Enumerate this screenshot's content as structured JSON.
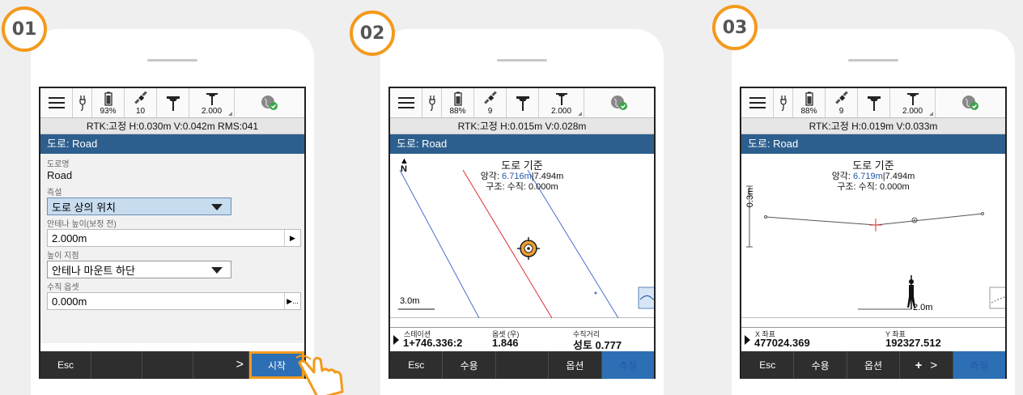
{
  "steps": [
    "01",
    "02",
    "03"
  ],
  "screen1": {
    "battery": "93%",
    "satellites": "10",
    "antenna": "2.000",
    "rtk": "RTK:고정 H:0.030m V:0.042m RMS:041",
    "title": "도로: Road",
    "road_name_label": "도로명",
    "road_name_value": "Road",
    "survey_label": "측설",
    "survey_value": "도로 상의 위치",
    "antenna_height_label": "안테나 높이(보정 전)",
    "antenna_height_value": "2.000m",
    "height_point_label": "높이 지점",
    "height_point_value": "안테나 마운트 하단",
    "vertical_offset_label": "수직 옵셋",
    "vertical_offset_value": "0.000m",
    "vertical_offset_btn": "▶...",
    "softkeys": {
      "esc": "Esc",
      "next": ">",
      "start": "시작"
    }
  },
  "screen2": {
    "battery": "88%",
    "satellites": "9",
    "antenna": "2.000",
    "rtk": "RTK:고정 H:0.015m V:0.028m",
    "title": "도로: Road",
    "map_heading": "도로 기준",
    "offset_prefix": "앙각: ",
    "offset_blue": "6.716m",
    "offset_rest": "|7.494m",
    "vertical": "구조: 수직: 0.000m",
    "north": "N",
    "scale": "3.0m",
    "station_label": "스테이션",
    "station_value": "1+746.336:2",
    "offset_label": "옵셋 (우)",
    "offset_value": "1.846",
    "vdist_label": "수직거리",
    "vdist_value": "성토 0.777",
    "softkeys": {
      "esc": "Esc",
      "accept": "수용",
      "options": "옵션",
      "measure": "측정"
    }
  },
  "screen3": {
    "battery": "88%",
    "satellites": "9",
    "antenna": "2.000",
    "rtk": "RTK:고정 H:0.019m V:0.033m",
    "title": "도로: Road",
    "map_heading": "도로 기준",
    "offset_prefix": "앙각: ",
    "offset_blue": "6.719m",
    "offset_rest": "|7.494m",
    "vertical": "구조: 수직: 0.000m",
    "vscale": "0.3m",
    "hscale": "2.0m",
    "x_label": "X 좌표",
    "x_value": "477024.369",
    "y_label": "Y 좌표",
    "y_value": "192327.512",
    "softkeys": {
      "esc": "Esc",
      "accept": "수용",
      "options": "옵션",
      "plus": "+",
      "next": ">",
      "measure": "측정"
    }
  },
  "colors": {
    "accent": "#f39a1d",
    "title_bar": "#2d5f8e",
    "softkey_blue": "#2d6fb5"
  },
  "icons": [
    "menu-icon",
    "power-plug-icon",
    "battery-icon",
    "satellite-icon",
    "receiver-icon",
    "antenna-pole-icon",
    "globe-check-icon",
    "hand-pointer-icon"
  ]
}
